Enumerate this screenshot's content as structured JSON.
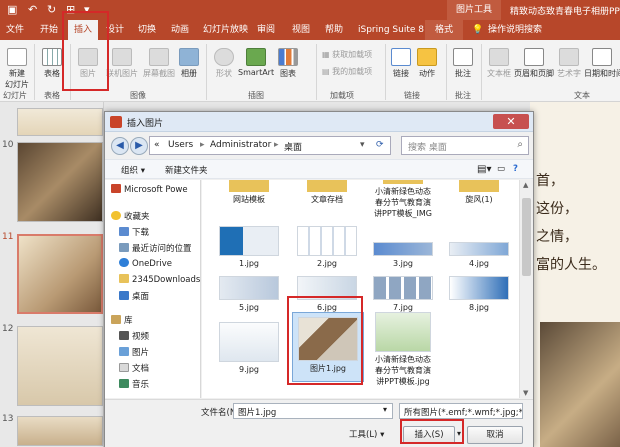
{
  "titlebar": {
    "context_label": "图片工具",
    "doc_title": "精致动态致青春电子相册PPT模板"
  },
  "tabs": {
    "items": [
      "文件",
      "开始",
      "插入",
      "设计",
      "切换",
      "动画",
      "幻灯片放映",
      "审阅",
      "视图",
      "帮助",
      "iSpring Suite 8",
      "格式",
      "操作说明搜索"
    ],
    "active": "插入"
  },
  "ribbon": {
    "new_slide": "新建\n幻灯片",
    "table": "表格",
    "picture": "图片",
    "online_picture": "联机图片",
    "screenshot": "屏幕截图",
    "album": "相册",
    "shapes": "形状",
    "smartart": "SmartArt",
    "chart": "图表",
    "get_addins": "获取加载项",
    "my_addins": "我的加载项",
    "link": "链接",
    "action": "动作",
    "comment": "批注",
    "textbox": "文本框",
    "header_footer": "页眉和页脚",
    "wordart": "艺术字",
    "datetime": "日期和时间",
    "groups": {
      "slides": "幻灯片",
      "tables": "表格",
      "images": "图像",
      "illustrations": "插图",
      "addins": "加载项",
      "links": "链接",
      "comments": "批注",
      "text": "文本"
    }
  },
  "slide_panel": {
    "numbers": [
      "10",
      "11",
      "12",
      "13"
    ]
  },
  "slide_area": {
    "lines": [
      "首，",
      "这份，",
      "之情，",
      "富的人生。"
    ]
  },
  "dialog": {
    "title": "插入图片",
    "close": "✕",
    "address": [
      "«",
      "Users",
      "Administrator",
      "桌面"
    ],
    "search_placeholder": "搜索 桌面",
    "toolbar": {
      "organize": "组织 ▾",
      "new_folder": "新建文件夹"
    },
    "nav": [
      {
        "label": "Microsoft Powe",
        "icon": "powerpoint-icon"
      },
      {
        "label": "收藏夹",
        "icon": "star-icon"
      },
      {
        "label": "下载",
        "icon": "download-icon"
      },
      {
        "label": "最近访问的位置",
        "icon": "recent-icon"
      },
      {
        "label": "OneDrive",
        "icon": "cloud-icon"
      },
      {
        "label": "2345Downloads",
        "icon": "folder-icon"
      },
      {
        "label": "桌面",
        "icon": "desktop-icon"
      },
      {
        "label": "库",
        "icon": "library-icon"
      },
      {
        "label": "视频",
        "icon": "video-icon"
      },
      {
        "label": "图片",
        "icon": "pictures-icon"
      },
      {
        "label": "文档",
        "icon": "documents-icon"
      },
      {
        "label": "音乐",
        "icon": "music-icon"
      }
    ],
    "files": [
      {
        "name": "网站模板",
        "kind": "folder"
      },
      {
        "name": "文章存档",
        "kind": "folder"
      },
      {
        "name": "小清新绿色动态\n春分节气教育演\n讲PPT模板_IMG",
        "kind": "folder"
      },
      {
        "name": "旋风(1)",
        "kind": "folder"
      },
      {
        "name": "1.jpg",
        "kind": "image"
      },
      {
        "name": "2.jpg",
        "kind": "image"
      },
      {
        "name": "3.jpg",
        "kind": "image"
      },
      {
        "name": "4.jpg",
        "kind": "image"
      },
      {
        "name": "5.jpg",
        "kind": "image"
      },
      {
        "name": "6.jpg",
        "kind": "image"
      },
      {
        "name": "7.jpg",
        "kind": "image"
      },
      {
        "name": "8.jpg",
        "kind": "image"
      },
      {
        "name": "9.jpg",
        "kind": "image"
      },
      {
        "name": "图片1.jpg",
        "kind": "image"
      },
      {
        "name": "小清新绿色动态\n春分节气教育演\n讲PPT模板.jpg",
        "kind": "image"
      }
    ],
    "filename_label": "文件名(N):",
    "filename_value": "图片1.jpg",
    "filetype_value": "所有图片(*.emf;*.wmf;*.jpg;*.jp",
    "tools": "工具(L)",
    "insert": "插入(S)",
    "cancel": "取消"
  },
  "colors": {
    "accent": "#b7472a",
    "highlight": "#d52828"
  }
}
